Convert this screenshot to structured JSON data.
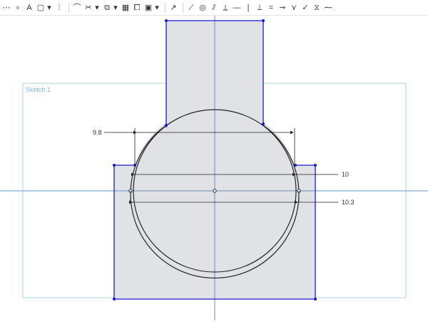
{
  "toolbar": {
    "tools": [
      {
        "name": "ellipsis-tool",
        "glyph": "⋯"
      },
      {
        "name": "point-tool",
        "glyph": "∘"
      },
      {
        "name": "text-tool",
        "glyph": "A"
      },
      {
        "name": "image-tool",
        "glyph": "▢"
      },
      {
        "name": "trim-tool",
        "glyph": "⫶"
      },
      {
        "name": "fillet-tool",
        "glyph": "⌒"
      },
      {
        "name": "scissors-tool",
        "glyph": "✂"
      },
      {
        "name": "offset-tool",
        "glyph": "⧉"
      },
      {
        "name": "pattern-tool",
        "glyph": "▦"
      },
      {
        "name": "mirror-tool",
        "glyph": "⧠"
      },
      {
        "name": "use-tool",
        "glyph": "▣"
      },
      {
        "name": "construction-tool",
        "glyph": "↗"
      },
      {
        "name": "coincident-tool",
        "glyph": "⟋"
      },
      {
        "name": "concentric-tool",
        "glyph": "◎"
      },
      {
        "name": "parallel-tool",
        "glyph": "⫽"
      },
      {
        "name": "tangent-tool",
        "glyph": "⟂"
      },
      {
        "name": "horizontal-tool",
        "glyph": "―"
      },
      {
        "name": "vertical-tool",
        "glyph": "|"
      },
      {
        "name": "perpendicular-tool",
        "glyph": "⊥"
      },
      {
        "name": "equal-tool",
        "glyph": "="
      },
      {
        "name": "midpoint-tool",
        "glyph": "⊸"
      },
      {
        "name": "normal-tool",
        "glyph": "⋎"
      },
      {
        "name": "fix-tool",
        "glyph": "✓"
      },
      {
        "name": "symmetric-tool",
        "glyph": "⧖"
      },
      {
        "name": "pierce-tool",
        "glyph": "⁓"
      }
    ]
  },
  "sketch": {
    "label": "Sketch 1"
  },
  "dimensions": {
    "top_width": "9.8",
    "middle_width": "10",
    "lower_width": "10.3"
  },
  "colors": {
    "profile_fill": "#e0e2e6",
    "profile_edge": "#1a1ad0",
    "axis": "#6a8fb8",
    "sketch_box": "#a8d4e3",
    "vertex": "#1a1ad0"
  }
}
